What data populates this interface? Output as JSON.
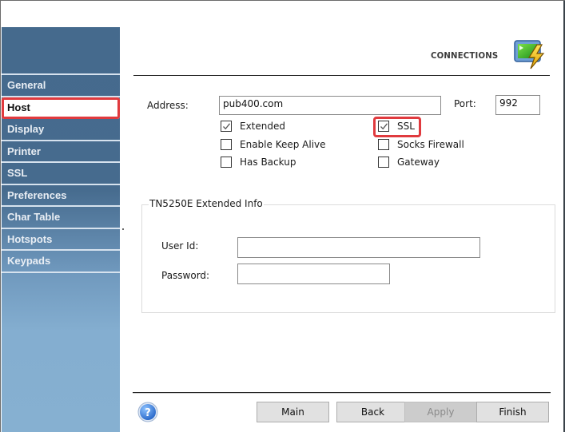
{
  "sidebar": {
    "items": [
      {
        "label": "General",
        "active": false
      },
      {
        "label": "Host",
        "active": true
      },
      {
        "label": "Display",
        "active": false
      },
      {
        "label": "Printer",
        "active": false
      },
      {
        "label": "SSL",
        "active": false
      },
      {
        "label": "Preferences",
        "active": false
      },
      {
        "label": "Char Table",
        "active": false
      },
      {
        "label": "Hotspots",
        "active": false
      },
      {
        "label": "Keypads",
        "active": false
      }
    ]
  },
  "header": {
    "title": "CONNECTIONS",
    "icon": "connections-lightning-icon"
  },
  "host": {
    "address_label": "Address:",
    "address_value": "pub400.com",
    "port_label": "Port:",
    "port_value": "992",
    "options": [
      {
        "label": "Extended",
        "checked": true
      },
      {
        "label": "Enable Keep Alive",
        "checked": false
      },
      {
        "label": "Has Backup",
        "checked": false
      },
      {
        "label": "SSL",
        "checked": true,
        "highlighted": true
      },
      {
        "label": "Socks Firewall",
        "checked": false
      },
      {
        "label": "Gateway",
        "checked": false
      }
    ]
  },
  "extended_info": {
    "legend": "TN5250E Extended Info",
    "user_id_label": "User Id:",
    "user_id_value": "",
    "password_label": "Password:",
    "password_value": ""
  },
  "footer": {
    "help_icon": "help-icon",
    "buttons": {
      "main": "Main",
      "back": "Back",
      "apply": "Apply",
      "finish": "Finish"
    },
    "apply_disabled": true
  },
  "colors": {
    "sidebar_top": "#456a8d",
    "sidebar_bottom": "#86b0d1",
    "highlight_red": "#e03a3e"
  }
}
